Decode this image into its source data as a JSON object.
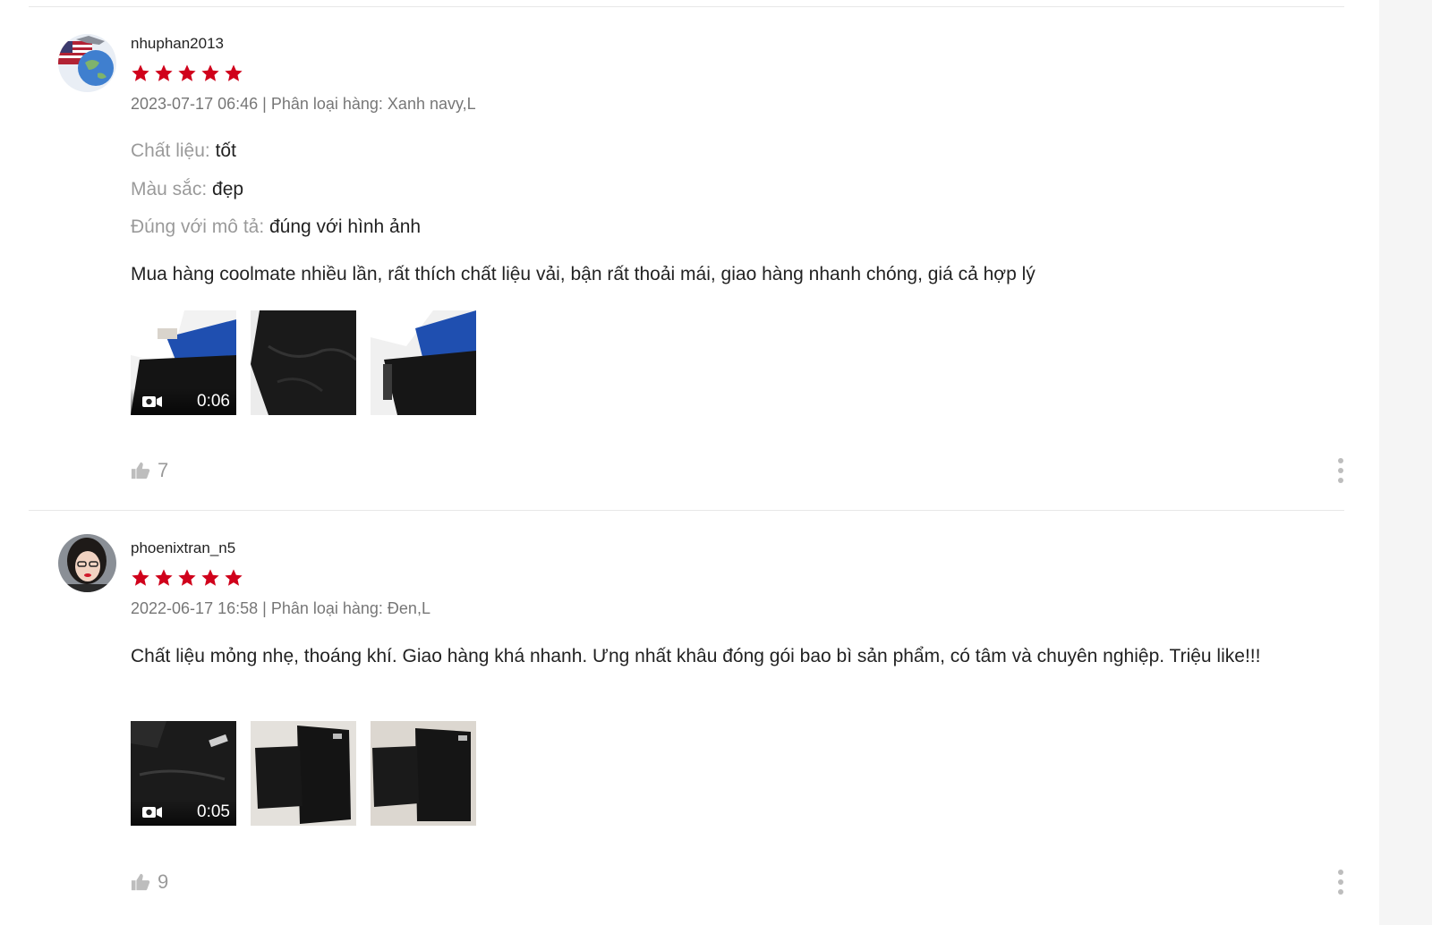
{
  "colors": {
    "star": "#d0011b",
    "muted": "#9e9e9e",
    "divider": "#e8e8e8"
  },
  "reviews": [
    {
      "author": "nhuphan2013",
      "rating": 5,
      "datetime": "2023-07-17 06:46",
      "separator": " | ",
      "variation_label": "Phân loại hàng: ",
      "variation": "Xanh navy,L",
      "attributes": [
        {
          "key": "Chất liệu: ",
          "value": "tốt"
        },
        {
          "key": "Màu sắc: ",
          "value": "đẹp"
        },
        {
          "key": "Đúng với mô tả: ",
          "value": "đúng với hình ảnh"
        }
      ],
      "comment": "Mua hàng coolmate nhiều lần, rất thích chất liệu vải, bận rất thoải mái, giao hàng nhanh chóng, giá cả hợp lý",
      "video_duration": "0:06",
      "likes": "7"
    },
    {
      "author": "phoenixtran_n5",
      "rating": 5,
      "datetime": "2022-06-17 16:58",
      "separator": " | ",
      "variation_label": "Phân loại hàng: ",
      "variation": "Đen,L",
      "comment": "Chất liệu mỏng nhẹ, thoáng khí. Giao hàng khá nhanh. Ưng nhất khâu đóng gói bao bì sản phẩm, có tâm và chuyên nghiệp. Triệu like!!!",
      "video_duration": "0:05",
      "likes": "9"
    }
  ]
}
